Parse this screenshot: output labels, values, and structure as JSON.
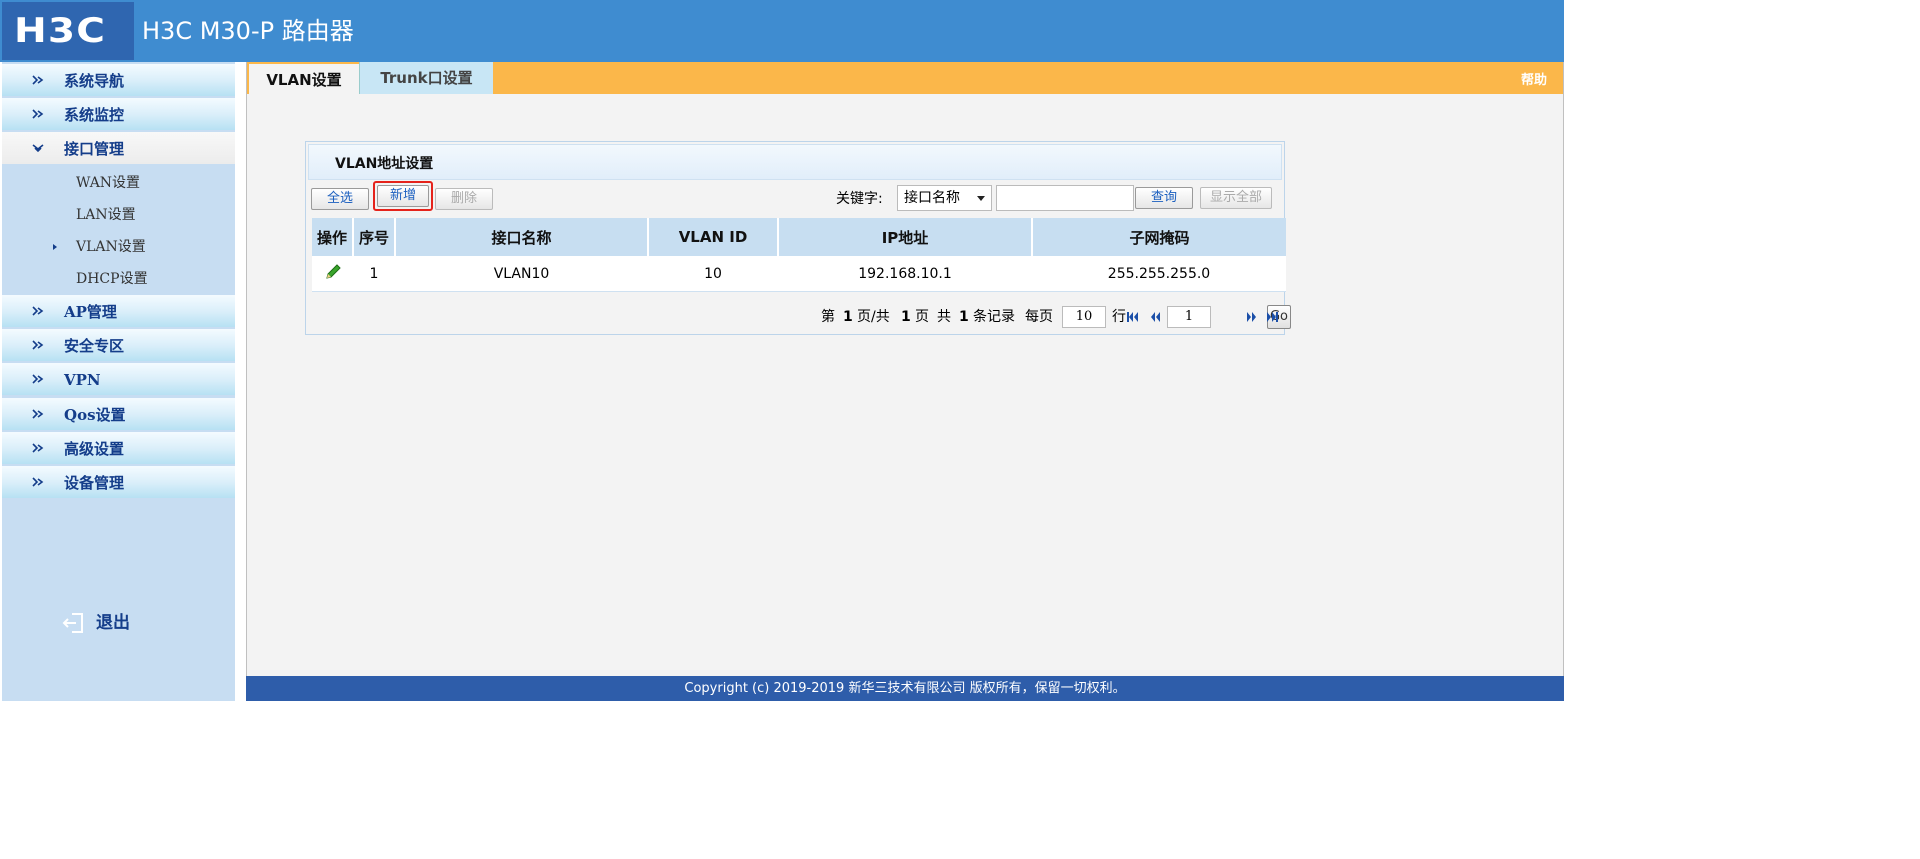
{
  "header": {
    "logo_text": "H3C",
    "product_title": "H3C M30-P 路由器"
  },
  "sidebar": {
    "menu": [
      {
        "label": "系统导航"
      },
      {
        "label": "系统监控"
      },
      {
        "label": "接口管理",
        "expanded": true,
        "children": [
          {
            "label": "WAN设置"
          },
          {
            "label": "LAN设置"
          },
          {
            "label": "VLAN设置",
            "active": true
          },
          {
            "label": "DHCP设置"
          }
        ]
      },
      {
        "label": "AP管理"
      },
      {
        "label": "安全专区"
      },
      {
        "label": "VPN"
      },
      {
        "label": "Qos设置"
      },
      {
        "label": "高级设置"
      },
      {
        "label": "设备管理"
      }
    ],
    "logout_label": "退出"
  },
  "tabs": [
    {
      "label": "VLAN设置",
      "active": true
    },
    {
      "label": "Trunk口设置",
      "active": false
    }
  ],
  "help_label": "帮助",
  "panel": {
    "title": "VLAN地址设置",
    "buttons": {
      "select_all": "全选",
      "add": "新增",
      "delete": "删除",
      "query": "查询",
      "show_all": "显示全部"
    },
    "keyword_label": "关键字:",
    "keyword_select_value": "接口名称",
    "keyword_input_value": "",
    "table": {
      "columns": [
        "操作",
        "序号",
        "接口名称",
        "VLAN ID",
        "IP地址",
        "子网掩码"
      ],
      "rows": [
        {
          "index": "1",
          "interface": "VLAN10",
          "vlan_id": "10",
          "ip": "192.168.10.1",
          "mask": "255.255.255.0"
        }
      ]
    },
    "pagination": {
      "prefix": "第",
      "current_page": "1",
      "page_sep": "页/共",
      "total_pages": "1",
      "page_suffix": "页",
      "total_prefix": "共",
      "total_records": "1",
      "records_suffix": "条记录",
      "per_page_label": "每页",
      "per_page_value": "10",
      "rows_label": "行",
      "goto_page_value": "1",
      "go_label": "Go"
    }
  },
  "footer": {
    "copyright": "Copyright (c) 2019-2019 新华三技术有限公司 版权所有，保留一切权利。"
  },
  "colors": {
    "header_blue": "#3f8cd0",
    "logo_blue": "#2f66b0",
    "tabbar_orange": "#fbb74a",
    "menu_text": "#143d8a",
    "footer_blue": "#2e5daa",
    "highlight_red": "#e5231b",
    "table_header": "#c7def1"
  },
  "icons": {
    "menu_bullet": "triangle-bullet-icon",
    "edit": "pencil-icon",
    "logout": "logout-icon",
    "pager": [
      "first-page-icon",
      "prev-page-icon",
      "next-page-icon",
      "last-page-icon"
    ]
  }
}
